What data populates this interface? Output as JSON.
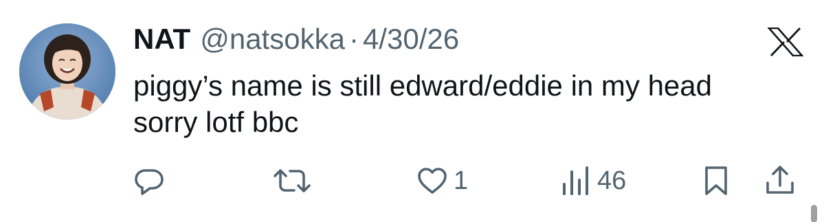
{
  "tweet": {
    "display_name": "NAT",
    "handle": "@natsokka",
    "separator": "·",
    "date": "4/30/26",
    "text_lines": [
      "piggy’s name is still edward/eddie in my head",
      "sorry lotf bbc"
    ]
  },
  "actions": {
    "reply": {
      "icon": "reply-icon",
      "count": ""
    },
    "retweet": {
      "icon": "retweet-icon",
      "count": ""
    },
    "like": {
      "icon": "heart-icon",
      "count": "1"
    },
    "views": {
      "icon": "views-bar-chart-icon",
      "count": "46"
    },
    "bookmark": {
      "icon": "bookmark-icon"
    },
    "share": {
      "icon": "share-icon"
    }
  },
  "colors": {
    "text_primary": "#0f1419",
    "text_secondary": "#536471",
    "background": "#ffffff"
  }
}
